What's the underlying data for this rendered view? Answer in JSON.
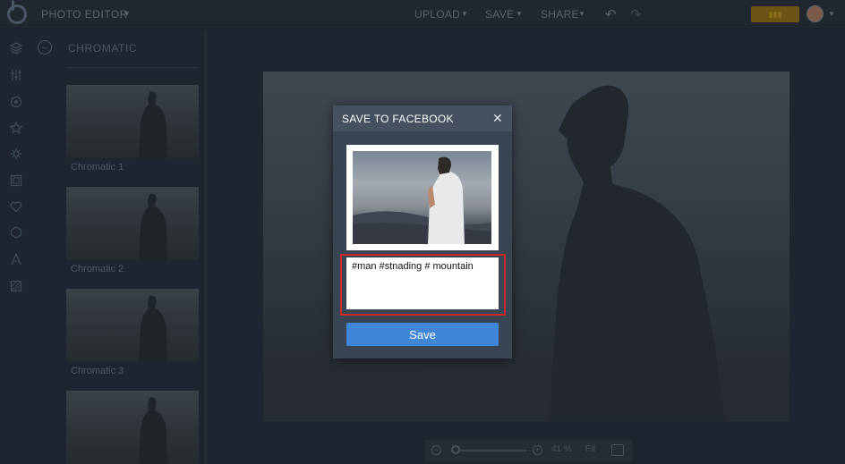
{
  "topbar": {
    "app_title": "PHOTO EDITOR",
    "menu": [
      {
        "label": "UPLOAD"
      },
      {
        "label": "SAVE"
      },
      {
        "label": "SHARE"
      }
    ],
    "undo_icon": "undo-icon",
    "redo_icon": "redo-icon"
  },
  "panel": {
    "title": "CHROMATIC",
    "thumbnails": [
      {
        "label": "Chromatic 1"
      },
      {
        "label": "Chromatic 2"
      },
      {
        "label": "Chromatic 3"
      },
      {
        "label": ""
      }
    ]
  },
  "zoom": {
    "value": "41 %",
    "fit_label": "Fit",
    "level_percent": 41
  },
  "modal": {
    "title": "SAVE TO FACEBOOK",
    "close_glyph": "✕",
    "caption_value": "#man #stnading # mountain",
    "save_label": "Save"
  },
  "colors": {
    "accent": "#3f86d6",
    "highlight": "#cc2a2a",
    "background": "#1e2530"
  }
}
